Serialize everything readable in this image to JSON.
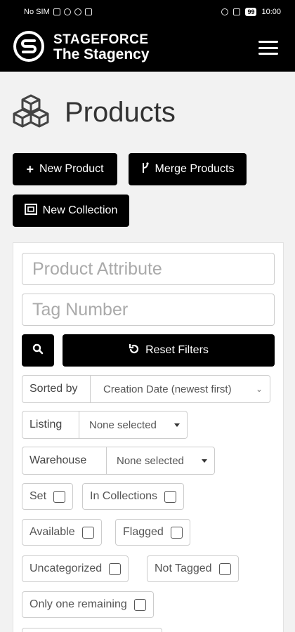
{
  "status_bar": {
    "carrier": "No SIM",
    "time": "10:00",
    "battery": "99"
  },
  "header": {
    "brand_line1": "STAGEFORCE",
    "brand_line2": "The Stagency",
    "menu_icon": "hamburger-icon"
  },
  "page": {
    "title": "Products",
    "title_icon": "cubes-icon"
  },
  "actions": {
    "new_product": "New Product",
    "merge_products": "Merge Products",
    "new_collection": "New Collection"
  },
  "filters": {
    "product_attribute_placeholder": "Product Attribute",
    "tag_number_placeholder": "Tag Number",
    "reset_label": "Reset Filters",
    "sorted_by_label": "Sorted by",
    "sorted_by_value": "Creation Date (newest first)",
    "listing_label": "Listing",
    "listing_value": "None selected",
    "warehouse_label": "Warehouse",
    "warehouse_value": "None selected",
    "checkboxes": {
      "set": "Set",
      "in_collections": "In Collections",
      "available": "Available",
      "flagged": "Flagged",
      "uncategorized": "Uncategorized",
      "not_tagged": "Not Tagged",
      "only_one_remaining": "Only one remaining"
    }
  }
}
